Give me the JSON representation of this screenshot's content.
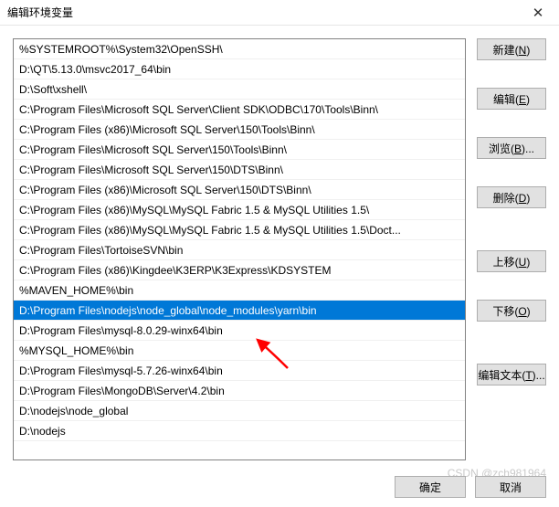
{
  "window": {
    "title": "编辑环境变量"
  },
  "list": {
    "items": [
      "%SYSTEMROOT%\\System32\\OpenSSH\\",
      "D:\\QT\\5.13.0\\msvc2017_64\\bin",
      "D:\\Soft\\xshell\\",
      "C:\\Program Files\\Microsoft SQL Server\\Client SDK\\ODBC\\170\\Tools\\Binn\\",
      "C:\\Program Files (x86)\\Microsoft SQL Server\\150\\Tools\\Binn\\",
      "C:\\Program Files\\Microsoft SQL Server\\150\\Tools\\Binn\\",
      "C:\\Program Files\\Microsoft SQL Server\\150\\DTS\\Binn\\",
      "C:\\Program Files (x86)\\Microsoft SQL Server\\150\\DTS\\Binn\\",
      "C:\\Program Files (x86)\\MySQL\\MySQL Fabric 1.5 & MySQL Utilities 1.5\\",
      "C:\\Program Files (x86)\\MySQL\\MySQL Fabric 1.5 & MySQL Utilities 1.5\\Doct...",
      "C:\\Program Files\\TortoiseSVN\\bin",
      "C:\\Program Files (x86)\\Kingdee\\K3ERP\\K3Express\\KDSYSTEM",
      "%MAVEN_HOME%\\bin",
      "D:\\Program Files\\nodejs\\node_global\\node_modules\\yarn\\bin",
      "D:\\Program Files\\mysql-8.0.29-winx64\\bin",
      "%MYSQL_HOME%\\bin",
      "D:\\Program Files\\mysql-5.7.26-winx64\\bin",
      "D:\\Program Files\\MongoDB\\Server\\4.2\\bin",
      "D:\\nodejs\\node_global",
      "D:\\nodejs"
    ],
    "selectedIndex": 13
  },
  "buttons": {
    "new": "新建(N)",
    "edit": "编辑(E)",
    "browse": "浏览(B)...",
    "delete": "删除(D)",
    "moveup": "上移(U)",
    "movedown": "下移(O)",
    "edittext": "编辑文本(T)...",
    "ok": "确定",
    "cancel": "取消"
  },
  "watermark": "CSDN @zch981964",
  "annotation": {
    "arrow_color": "#ff0000"
  }
}
